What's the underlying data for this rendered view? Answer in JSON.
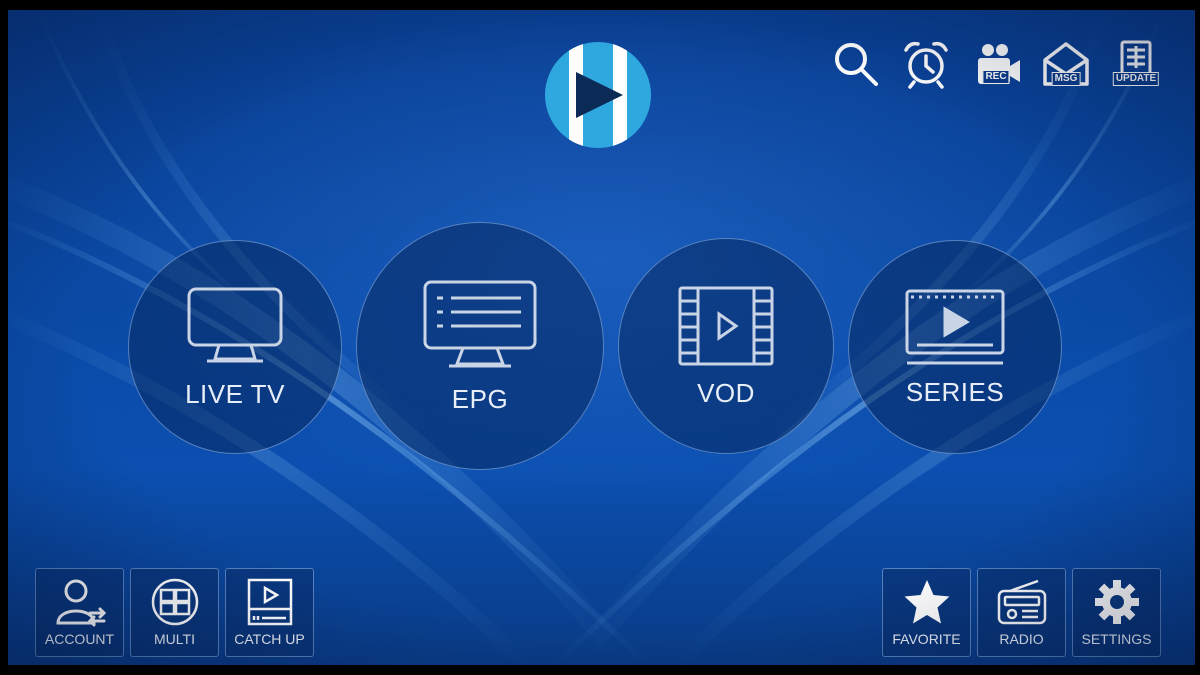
{
  "app": {
    "logo_icon": "xtream-play-logo",
    "accent": "#2aa6dd"
  },
  "top_bar": [
    {
      "name": "search",
      "icon": "search-icon",
      "label": ""
    },
    {
      "name": "alarm",
      "icon": "alarm-clock-icon",
      "label": ""
    },
    {
      "name": "record",
      "icon": "camera-icon",
      "label": "REC"
    },
    {
      "name": "messages",
      "icon": "envelope-icon",
      "label": "MSG"
    },
    {
      "name": "update",
      "icon": "update-icon",
      "label": "UPDATE"
    }
  ],
  "main_menu": [
    {
      "label": "LIVE TV",
      "icon": "tv-icon"
    },
    {
      "label": "EPG",
      "icon": "epg-icon"
    },
    {
      "label": "VOD",
      "icon": "film-icon"
    },
    {
      "label": "SERIES",
      "icon": "series-icon"
    }
  ],
  "bottom_left": [
    {
      "label": "ACCOUNT",
      "icon": "account-icon"
    },
    {
      "label": "MULTI",
      "icon": "multi-screen-icon"
    },
    {
      "label": "CATCH UP",
      "icon": "catch-up-icon"
    }
  ],
  "bottom_right": [
    {
      "label": "FAVORITE",
      "icon": "star-icon"
    },
    {
      "label": "RADIO",
      "icon": "radio-icon"
    },
    {
      "label": "SETTINGS",
      "icon": "gear-icon"
    }
  ]
}
